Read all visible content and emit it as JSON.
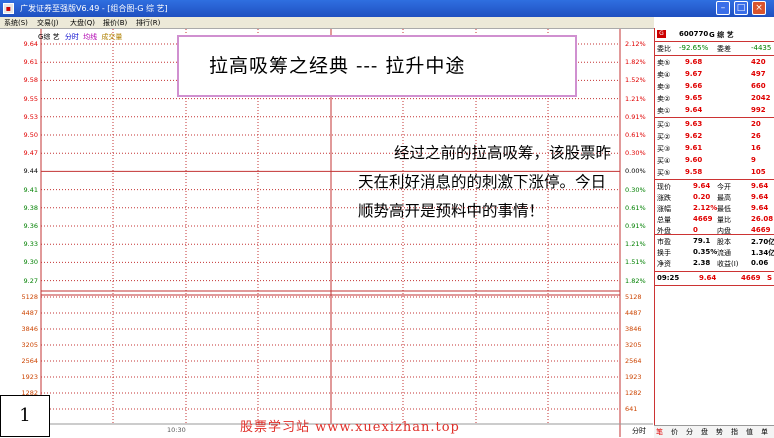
{
  "window": {
    "title": "广发证券至强版V6.49 - [组合图-G 综  艺]"
  },
  "menu": [
    "系统(S)",
    "交易(J)",
    "大盘(Q)",
    "报价(B)",
    "排行(R)"
  ],
  "chart_header": {
    "name": "G综 艺",
    "item1": "分时",
    "item2": "均线",
    "item3": "成交量"
  },
  "price_axis_left": [
    "9.64",
    "9.61",
    "9.58",
    "9.55",
    "9.53",
    "9.50",
    "9.47",
    "9.44",
    "9.41",
    "9.38",
    "9.36",
    "9.33",
    "9.30",
    "9.27"
  ],
  "price_axis_right": [
    "2.12%",
    "1.82%",
    "1.52%",
    "1.21%",
    "0.91%",
    "0.61%",
    "0.30%",
    "0.00%",
    "0.30%",
    "0.61%",
    "0.91%",
    "1.21%",
    "1.51%",
    "1.82%"
  ],
  "volume_axis_left": [
    "5128",
    "4487",
    "3846",
    "3205",
    "2564",
    "1923",
    "1282"
  ],
  "volume_axis_right": [
    "5128",
    "4487",
    "3846",
    "3205",
    "2564",
    "1923",
    "1282",
    "641"
  ],
  "time_label": "10:30",
  "fenshi_label": "分时",
  "callout": "拉高吸筹之经典 --- 拉升中途",
  "note": "经过之前的拉高吸筹，该股票昨天在利好消息的的刺激下涨停。今日顺势高开是预料中的事情！",
  "slide_number": "1",
  "watermark": "股票学习站  www.xuexizhan.top",
  "stock": {
    "code": "600770",
    "name": "G 综 艺",
    "icon_label": "G"
  },
  "ratio": {
    "weibi_label": "委比",
    "weibi": "-92.65%",
    "weicha_label": "委差",
    "weicha": "-4435"
  },
  "sell_orders": [
    {
      "label": "卖⑤",
      "price": "9.68",
      "vol": "420"
    },
    {
      "label": "卖④",
      "price": "9.67",
      "vol": "497"
    },
    {
      "label": "卖③",
      "price": "9.66",
      "vol": "660"
    },
    {
      "label": "卖②",
      "price": "9.65",
      "vol": "2042"
    },
    {
      "label": "卖①",
      "price": "9.64",
      "vol": "992"
    }
  ],
  "buy_orders": [
    {
      "label": "买①",
      "price": "9.63",
      "vol": "20"
    },
    {
      "label": "买②",
      "price": "9.62",
      "vol": "26"
    },
    {
      "label": "买③",
      "price": "9.61",
      "vol": "16"
    },
    {
      "label": "买④",
      "price": "9.60",
      "vol": "9"
    },
    {
      "label": "买⑤",
      "price": "9.58",
      "vol": "105"
    }
  ],
  "quote": [
    {
      "l1": "现价",
      "v1": "9.64",
      "l2": "今开",
      "v2": "9.64"
    },
    {
      "l1": "涨跌",
      "v1": "0.20",
      "l2": "最高",
      "v2": "9.64"
    },
    {
      "l1": "涨幅",
      "v1": "2.12%",
      "l2": "最低",
      "v2": "9.64"
    },
    {
      "l1": "总量",
      "v1": "4669",
      "l2": "量比",
      "v2": "26.08"
    },
    {
      "l1": "外盘",
      "v1": "0",
      "l2": "内盘",
      "v2": "4669"
    }
  ],
  "fundamentals": [
    {
      "l1": "市盈",
      "v1": "79.1",
      "l2": "股本",
      "v2": "2.70亿"
    },
    {
      "l1": "换手",
      "v1": "0.35%",
      "l2": "流通",
      "v2": "1.34亿"
    },
    {
      "l1": "净资",
      "v1": "2.38",
      "l2": "收益(I)",
      "v2": "0.06"
    }
  ],
  "tick": {
    "time": "09:25",
    "price": "9.64",
    "vol": "4669",
    "flag": "S"
  },
  "bottom_tabs": [
    "笔",
    "价",
    "分",
    "盘",
    "势",
    "指",
    "值",
    "单"
  ],
  "colors": {
    "up": "#e00000",
    "down": "#008000",
    "grid_red": "#c33333",
    "titlebar": "#2f6fe0",
    "callout_border": "#d090d0",
    "watermark": "#e0302a"
  }
}
